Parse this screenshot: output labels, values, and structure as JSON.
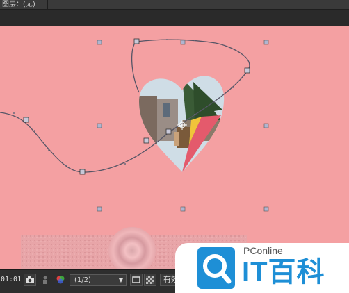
{
  "panel": {
    "title": "图层：(无)"
  },
  "toolbar": {
    "timecode": "01:01",
    "resolution": "(1/2)",
    "more_label": "有效"
  },
  "icons": [
    "camera-icon",
    "person-icon",
    "color-channels-icon",
    "chevron-down-icon",
    "region-of-interest-icon",
    "transparency-grid-icon"
  ],
  "watermark": {
    "subtitle": "PConline",
    "brand": "IT百科",
    "accent": "#1e8fd6"
  },
  "colors": {
    "canvas_bg": "#f4a0a2",
    "path": "#555566",
    "heart_mask_fill": "#d9d1cf"
  }
}
